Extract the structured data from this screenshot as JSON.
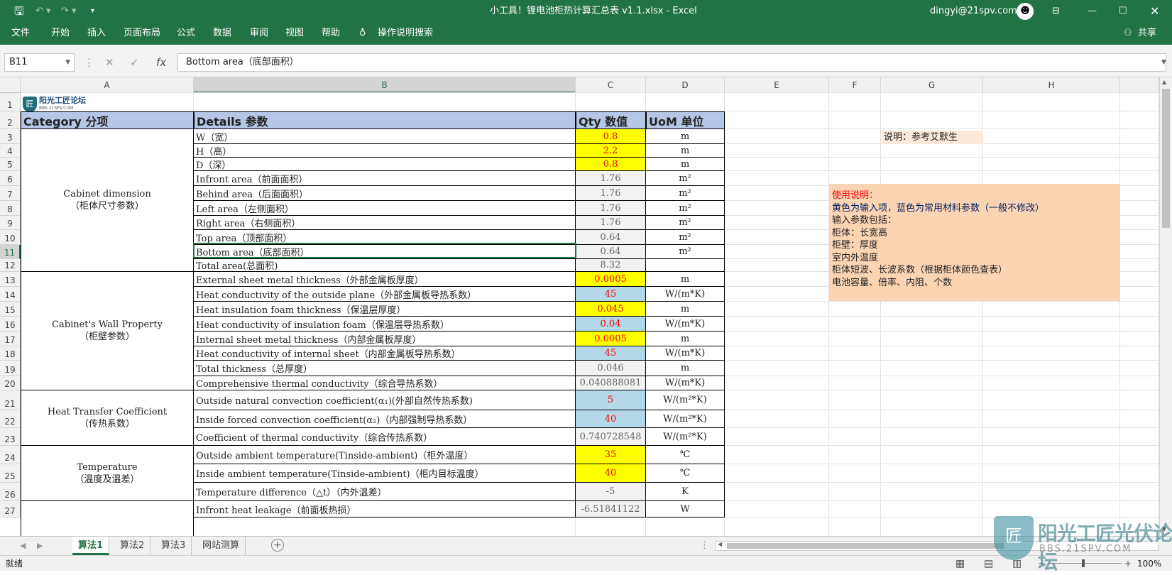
{
  "window": {
    "title": "小工具！锂电池柜热计算汇总表 v1.1.xlsx  -  Excel",
    "user": "dingyi@21spv.com",
    "share": "共享"
  },
  "menu": [
    "文件",
    "开始",
    "插入",
    "页面布局",
    "公式",
    "数据",
    "审阅",
    "视图",
    "帮助"
  ],
  "tell_me": "操作说明搜索",
  "formula_bar": {
    "name_box": "B11",
    "formula": "Bottom area（底部面积）"
  },
  "columns": [
    "A",
    "B",
    "C",
    "D",
    "E",
    "F",
    "G",
    "H"
  ],
  "logo": {
    "name": "阳光工匠论坛",
    "url": "BBS.21SPV.COM"
  },
  "header": {
    "category": "Category 分项",
    "details": "Details 参数",
    "qty": "Qty 数值",
    "uom": "UoM 单位"
  },
  "categories": [
    {
      "label": "Cabinet dimension",
      "sub": "（柜体尺寸参数）"
    },
    {
      "label": "Cabinet's Wall Property",
      "sub": "（柜壁参数）"
    },
    {
      "label": "Heat Transfer Coefficient",
      "sub": "（传热系数）"
    },
    {
      "label": "Temperature",
      "sub": "（温度及温差）"
    }
  ],
  "rows": [
    {
      "n": "1"
    },
    {
      "n": "2"
    },
    {
      "n": "3",
      "b": "W（宽）",
      "c": "0.8",
      "d": "m",
      "s": "yellow"
    },
    {
      "n": "4",
      "b": "H（高）",
      "c": "2.2",
      "d": "m",
      "s": "yellow"
    },
    {
      "n": "5",
      "b": "D（深）",
      "c": "0.8",
      "d": "m",
      "s": "yellow"
    },
    {
      "n": "6",
      "b": "Infront area（前面面积）",
      "c": "1.76",
      "d": "m²",
      "s": "gray"
    },
    {
      "n": "7",
      "b": "Behind area（后面面积）",
      "c": "1.76",
      "d": "m²",
      "s": "gray"
    },
    {
      "n": "8",
      "b": "Left area（左侧面积）",
      "c": "1.76",
      "d": "m²",
      "s": "gray"
    },
    {
      "n": "9",
      "b": "Right area（右侧面积）",
      "c": "1.76",
      "d": "m²",
      "s": "gray"
    },
    {
      "n": "10",
      "b": "Top area（顶部面积）",
      "c": "0.64",
      "d": "m²",
      "s": "gray"
    },
    {
      "n": "11",
      "b": "Bottom area（底部面积）",
      "c": "0.64",
      "d": "m²",
      "s": "gray"
    },
    {
      "n": "12",
      "b": "Total area(总面积)",
      "c": "8.32",
      "d": "",
      "s": "gray"
    },
    {
      "n": "13",
      "b": "External sheet metal thickness（外部金属板厚度）",
      "c": "0.0005",
      "d": "m",
      "s": "yellow"
    },
    {
      "n": "14",
      "b": "Heat conductivity of the outside plane（外部金属板导热系数）",
      "c": "45",
      "d": "W/(m*K)",
      "s": "blue"
    },
    {
      "n": "15",
      "b": "Heat insulation foam thickness（保温层厚度）",
      "c": "0.045",
      "d": "m",
      "s": "yellow"
    },
    {
      "n": "16",
      "b": "Heat conductivity of  insulation foam（保温层导热系数）",
      "c": "0.04",
      "d": "W/(m*K)",
      "s": "blue"
    },
    {
      "n": "17",
      "b": "Internal sheet metal thickness（内部金属板厚度）",
      "c": "0.0005",
      "d": "m",
      "s": "yellow"
    },
    {
      "n": "18",
      "b": "Heat conductivity of internal sheet（内部金属板导热系数）",
      "c": "45",
      "d": "W/(m*K)",
      "s": "blue"
    },
    {
      "n": "19",
      "b": "Total thickness（总厚度）",
      "c": "0.046",
      "d": "m",
      "s": "gray"
    },
    {
      "n": "20",
      "b": "Comprehensive thermal conductivity（综合导热系数）",
      "c": "0.040888081",
      "d": "W/(m*K)",
      "s": "gray"
    },
    {
      "n": "21",
      "b": "Outside natural convection coefficient(α₁)(外部自然传热系数)",
      "c": "5",
      "d": "W/(m²*K)",
      "s": "blue"
    },
    {
      "n": "22",
      "b": "Inside forced convection coefficient(α₂)（内部强制导热系数）",
      "c": "40",
      "d": "W/(m²*K)",
      "s": "blue"
    },
    {
      "n": "23",
      "b": "Coefficient of thermal conductivity（综合传热系数）",
      "c": "0.740728548",
      "d": "W/(m²*K)",
      "s": "gray"
    },
    {
      "n": "24",
      "b": "Outside ambient temperature(Tinside-ambient)（柜外温度）",
      "c": "35",
      "d": "℃",
      "s": "yellow"
    },
    {
      "n": "25",
      "b": "Inside ambient temperature(Tinside-ambient)（柜内目标温度）",
      "c": "40",
      "d": "℃",
      "s": "yellow"
    },
    {
      "n": "26",
      "b": "Temperature difference（△t）（内外温差）",
      "c": "-5",
      "d": "K",
      "s": "gray"
    },
    {
      "n": "27",
      "b": "Infront heat leakage（前面板热损）",
      "c": "-6.51841122",
      "d": "W",
      "s": "gray"
    }
  ],
  "note_ref": "说明：参考艾默生",
  "note_usage": {
    "title": "使用说明：",
    "line1": "黄色为输入项，蓝色为常用材料参数（一般不修改）",
    "line2": "输入参数包括：",
    "line3": "柜体：长宽高",
    "line4": "柜壁：厚度",
    "line5": "室内外温度",
    "line6": "柜体短波、长波系数（根据柜体颜色查表）",
    "line7": "电池容量、倍率、内阻、个数"
  },
  "sheet_tabs": [
    "算法1",
    "算法2",
    "算法3",
    "网站测算"
  ],
  "active_tab": "算法1",
  "status": {
    "ready": "就绪",
    "zoom": "100%"
  },
  "watermark": {
    "text": "阳光工匠光伏论坛",
    "url": "BBS.21SPV.COM"
  }
}
